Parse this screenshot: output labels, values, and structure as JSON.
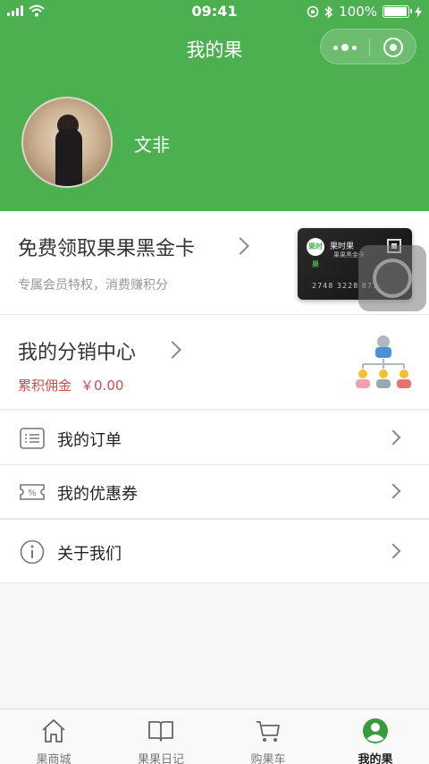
{
  "status_bar": {
    "time": "09:41",
    "battery": "100%"
  },
  "nav": {
    "title": "我的果"
  },
  "profile": {
    "name": "文非"
  },
  "vip_card": {
    "title": "免费领取果果黑金卡",
    "subtitle": "专属会员特权，消费赚积分",
    "card_logo": "果时果",
    "card_name": "果时果",
    "card_type": "果果黑金卡",
    "card_number": "2748 3228 8776"
  },
  "distribution": {
    "title": "我的分销中心",
    "commission_label": "累积佣金",
    "commission_value": "￥0.00"
  },
  "menu": [
    {
      "label": "我的订单",
      "icon": "list-icon"
    },
    {
      "label": "我的优惠券",
      "icon": "coupon-icon"
    },
    {
      "label": "关于我们",
      "icon": "info-icon"
    }
  ],
  "tabs": [
    {
      "label": "果商城",
      "icon": "home-icon"
    },
    {
      "label": "果果日记",
      "icon": "book-icon"
    },
    {
      "label": "购果车",
      "icon": "cart-icon"
    },
    {
      "label": "我的果",
      "icon": "user-icon",
      "active": true
    }
  ],
  "colors": {
    "brand_green": "#4caf50",
    "commission_red": "#d14c4c"
  }
}
